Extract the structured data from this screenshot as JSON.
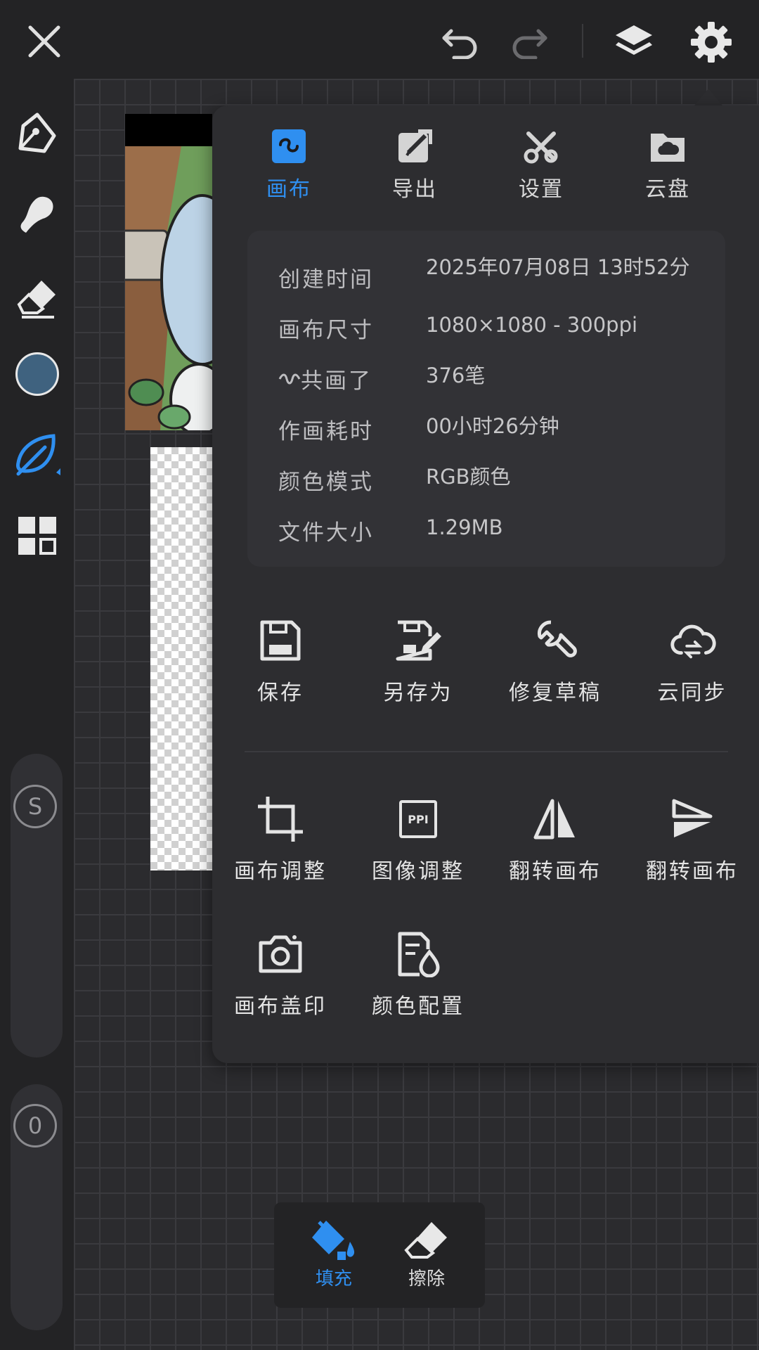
{
  "colors": {
    "accent": "#2f8ff0",
    "current_color": "#3f627f"
  },
  "topbar": {
    "icons": [
      "close-icon",
      "undo-icon",
      "redo-icon",
      "layers-icon",
      "gear-icon"
    ]
  },
  "left_toolbar": {
    "icons": [
      "brush-icon",
      "smudge-icon",
      "eraser-icon",
      "color-swatch",
      "leaf-brush-icon",
      "grid-icon"
    ],
    "size_label": "S",
    "opacity_label": "0"
  },
  "panel": {
    "tabs": [
      {
        "label": "画布",
        "icon": "canvas-icon",
        "active": true
      },
      {
        "label": "导出",
        "icon": "export-icon",
        "active": false
      },
      {
        "label": "设置",
        "icon": "settings-tools-icon",
        "active": false
      },
      {
        "label": "云盘",
        "icon": "cloud-folder-icon",
        "active": false
      }
    ],
    "info": [
      {
        "key": "创建时间",
        "value": "2025年07月08日  13时52分"
      },
      {
        "key": "画布尺寸",
        "value": "1080×1080 - 300ppi"
      },
      {
        "key": "共画了",
        "value": "376笔"
      },
      {
        "key": "作画耗时",
        "value": "00小时26分钟"
      },
      {
        "key": "颜色模式",
        "value": "RGB颜色"
      },
      {
        "key": "文件大小",
        "value": "1.29MB"
      }
    ],
    "actions_row1": [
      {
        "label": "保存",
        "icon": "save-icon"
      },
      {
        "label": "另存为",
        "icon": "save-as-icon"
      },
      {
        "label": "修复草稿",
        "icon": "wrench-icon"
      },
      {
        "label": "云同步",
        "icon": "cloud-sync-icon"
      }
    ],
    "actions_row2": [
      {
        "label": "画布调整",
        "icon": "crop-icon"
      },
      {
        "label": "图像调整",
        "icon": "ppi-icon",
        "icon_text": "PPI"
      },
      {
        "label": "翻转画布",
        "icon": "flip-horizontal-icon"
      },
      {
        "label": "翻转画布",
        "icon": "flip-vertical-icon"
      }
    ],
    "actions_row3": [
      {
        "label": "画布盖印",
        "icon": "camera-icon"
      },
      {
        "label": "颜色配置",
        "icon": "color-profile-icon"
      }
    ]
  },
  "fill_bar": {
    "fill_label": "填充",
    "erase_label": "擦除"
  }
}
